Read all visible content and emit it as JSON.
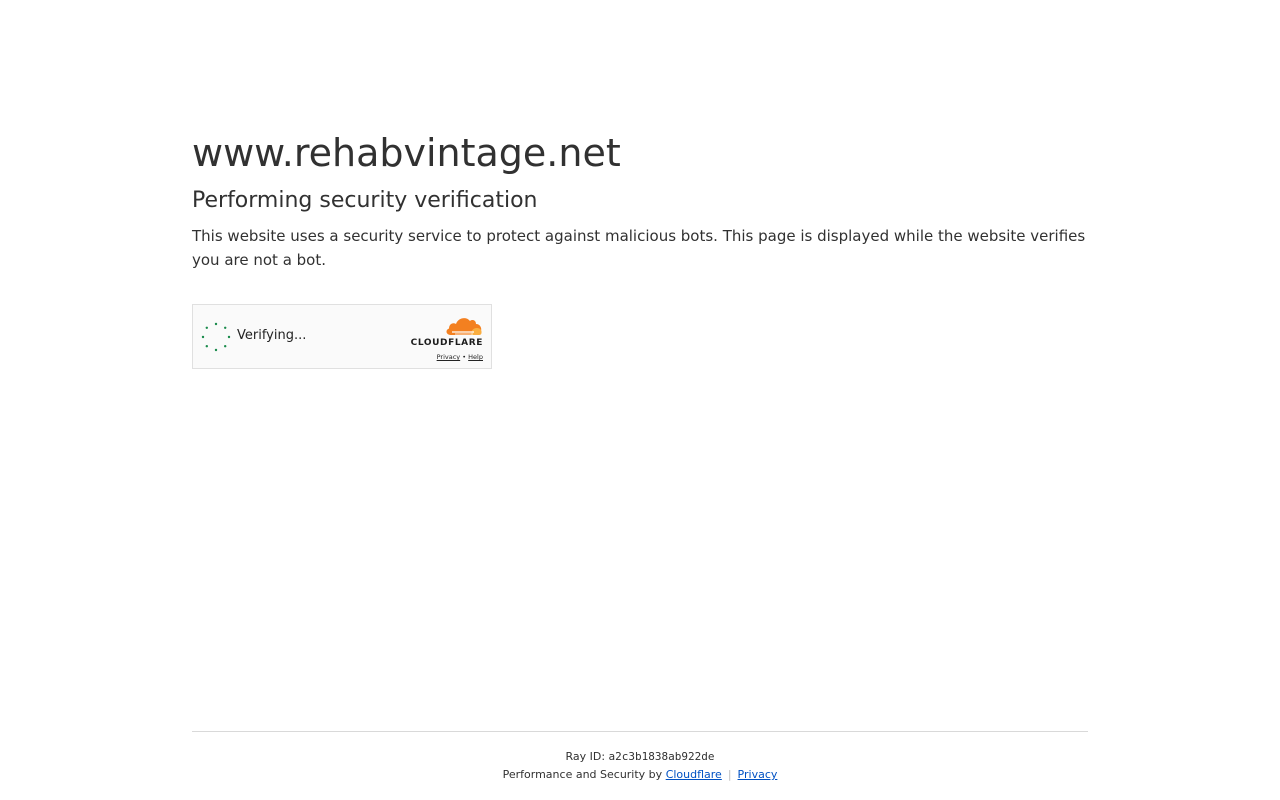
{
  "page": {
    "host": "www.rehabvintage.net",
    "subtitle": "Performing security verification",
    "description": "This website uses a security service to protect against malicious bots. This page is displayed while the website verifies you are not a bot."
  },
  "widget": {
    "status": "Verifying...",
    "brand": "CLOUDFLARE",
    "privacy_link": "Privacy",
    "link_separator": "•",
    "help_link": "Help",
    "icons": [
      "spinner-icon",
      "cloudflare-cloud-icon"
    ],
    "colors": {
      "spinner": "#1a8b4c",
      "cloud_primary": "#f38020",
      "cloud_secondary": "#faae40"
    }
  },
  "footer": {
    "ray_label": "Ray ID:",
    "ray_id": "a2c3b1838ab922de",
    "perf_text": "Performance and Security by",
    "cloudflare_link": "Cloudflare",
    "separator": "|",
    "privacy_link": "Privacy",
    "link_color": "#0051c3"
  }
}
